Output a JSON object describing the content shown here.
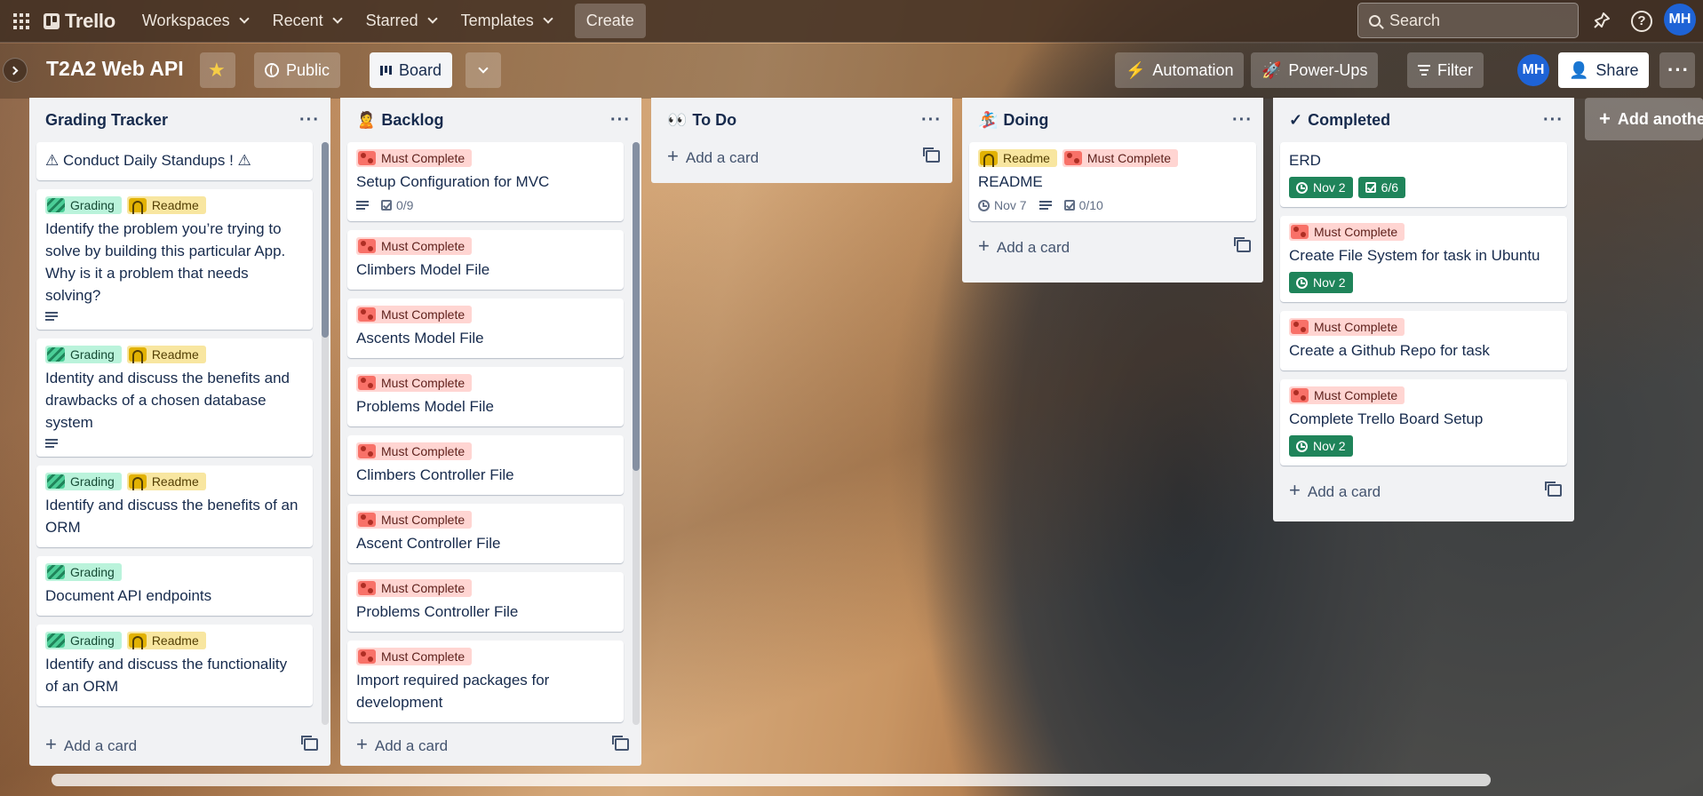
{
  "nav": {
    "logo": "Trello",
    "menu": [
      "Workspaces",
      "Recent",
      "Starred",
      "Templates"
    ],
    "create": "Create",
    "search_placeholder": "Search",
    "avatar": "MH"
  },
  "board": {
    "title": "T2A2 Web API",
    "visibility": "Public",
    "view": "Board",
    "automation": "Automation",
    "powerups": "Power-Ups",
    "filter": "Filter",
    "member": "MH",
    "share": "Share"
  },
  "lists": [
    {
      "title": "Grading Tracker",
      "emoji": "",
      "cards": [
        {
          "title": "⚠ Conduct Daily Standups ! ⚠",
          "labels": []
        },
        {
          "title": "Identify the problem you’re trying to solve by building this particular App. Why is it a problem that needs solving?",
          "labels": [
            "Grading",
            "Readme"
          ]
        },
        {
          "title": "Identity and discuss the benefits and drawbacks of a chosen database system",
          "labels": [
            "Grading",
            "Readme"
          ]
        },
        {
          "title": "Identify and discuss the benefits of an ORM",
          "labels": [
            "Grading",
            "Readme"
          ]
        },
        {
          "title": "Document API endpoints",
          "labels": [
            "Grading"
          ]
        },
        {
          "title": "Identify and discuss the functionality of an ORM",
          "labels": [
            "Grading",
            "Readme"
          ]
        }
      ],
      "add": "Add a card"
    },
    {
      "title": "Backlog",
      "emoji": "🙎",
      "cards": [
        {
          "title": "Setup Configuration for MVC",
          "labels": [
            "Must Complete"
          ],
          "checklist": "0/9"
        },
        {
          "title": "Climbers Model File",
          "labels": [
            "Must Complete"
          ]
        },
        {
          "title": "Ascents Model File",
          "labels": [
            "Must Complete"
          ]
        },
        {
          "title": "Problems Model File",
          "labels": [
            "Must Complete"
          ]
        },
        {
          "title": "Climbers Controller File",
          "labels": [
            "Must Complete"
          ]
        },
        {
          "title": "Ascent Controller File",
          "labels": [
            "Must Complete"
          ]
        },
        {
          "title": "Problems Controller File",
          "labels": [
            "Must Complete"
          ]
        },
        {
          "title": "Import required packages for development",
          "labels": [
            "Must Complete"
          ]
        }
      ],
      "add": "Add a card"
    },
    {
      "title": "To Do",
      "emoji": "👀",
      "cards": [],
      "add": "Add a card"
    },
    {
      "title": "Doing",
      "emoji": "🏂",
      "cards": [
        {
          "title": "README",
          "labels": [
            "Readme",
            "Must Complete"
          ],
          "due": "Nov 7",
          "checklist": "0/10"
        }
      ],
      "add": "Add a card"
    },
    {
      "title": "Completed",
      "emoji": "✓",
      "cards": [
        {
          "title": "ERD",
          "labels": [],
          "due": "Nov 2",
          "checklist": "6/6"
        },
        {
          "title": "Create File System for task in Ubuntu",
          "labels": [
            "Must Complete"
          ],
          "due": "Nov 2"
        },
        {
          "title": "Create a Github Repo for task",
          "labels": [
            "Must Complete"
          ]
        },
        {
          "title": "Complete Trello Board Setup",
          "labels": [
            "Must Complete"
          ],
          "due": "Nov 2"
        }
      ],
      "add": "Add a card"
    }
  ],
  "add_list": "Add another list",
  "label_names": {
    "grading": "Grading",
    "readme": "Readme",
    "must": "Must Complete"
  },
  "colors": {
    "must": "#f87168",
    "grading": "#4bce97",
    "readme": "#e2b203",
    "due_complete": "#1f845a",
    "avatar": "#1e63d6"
  }
}
